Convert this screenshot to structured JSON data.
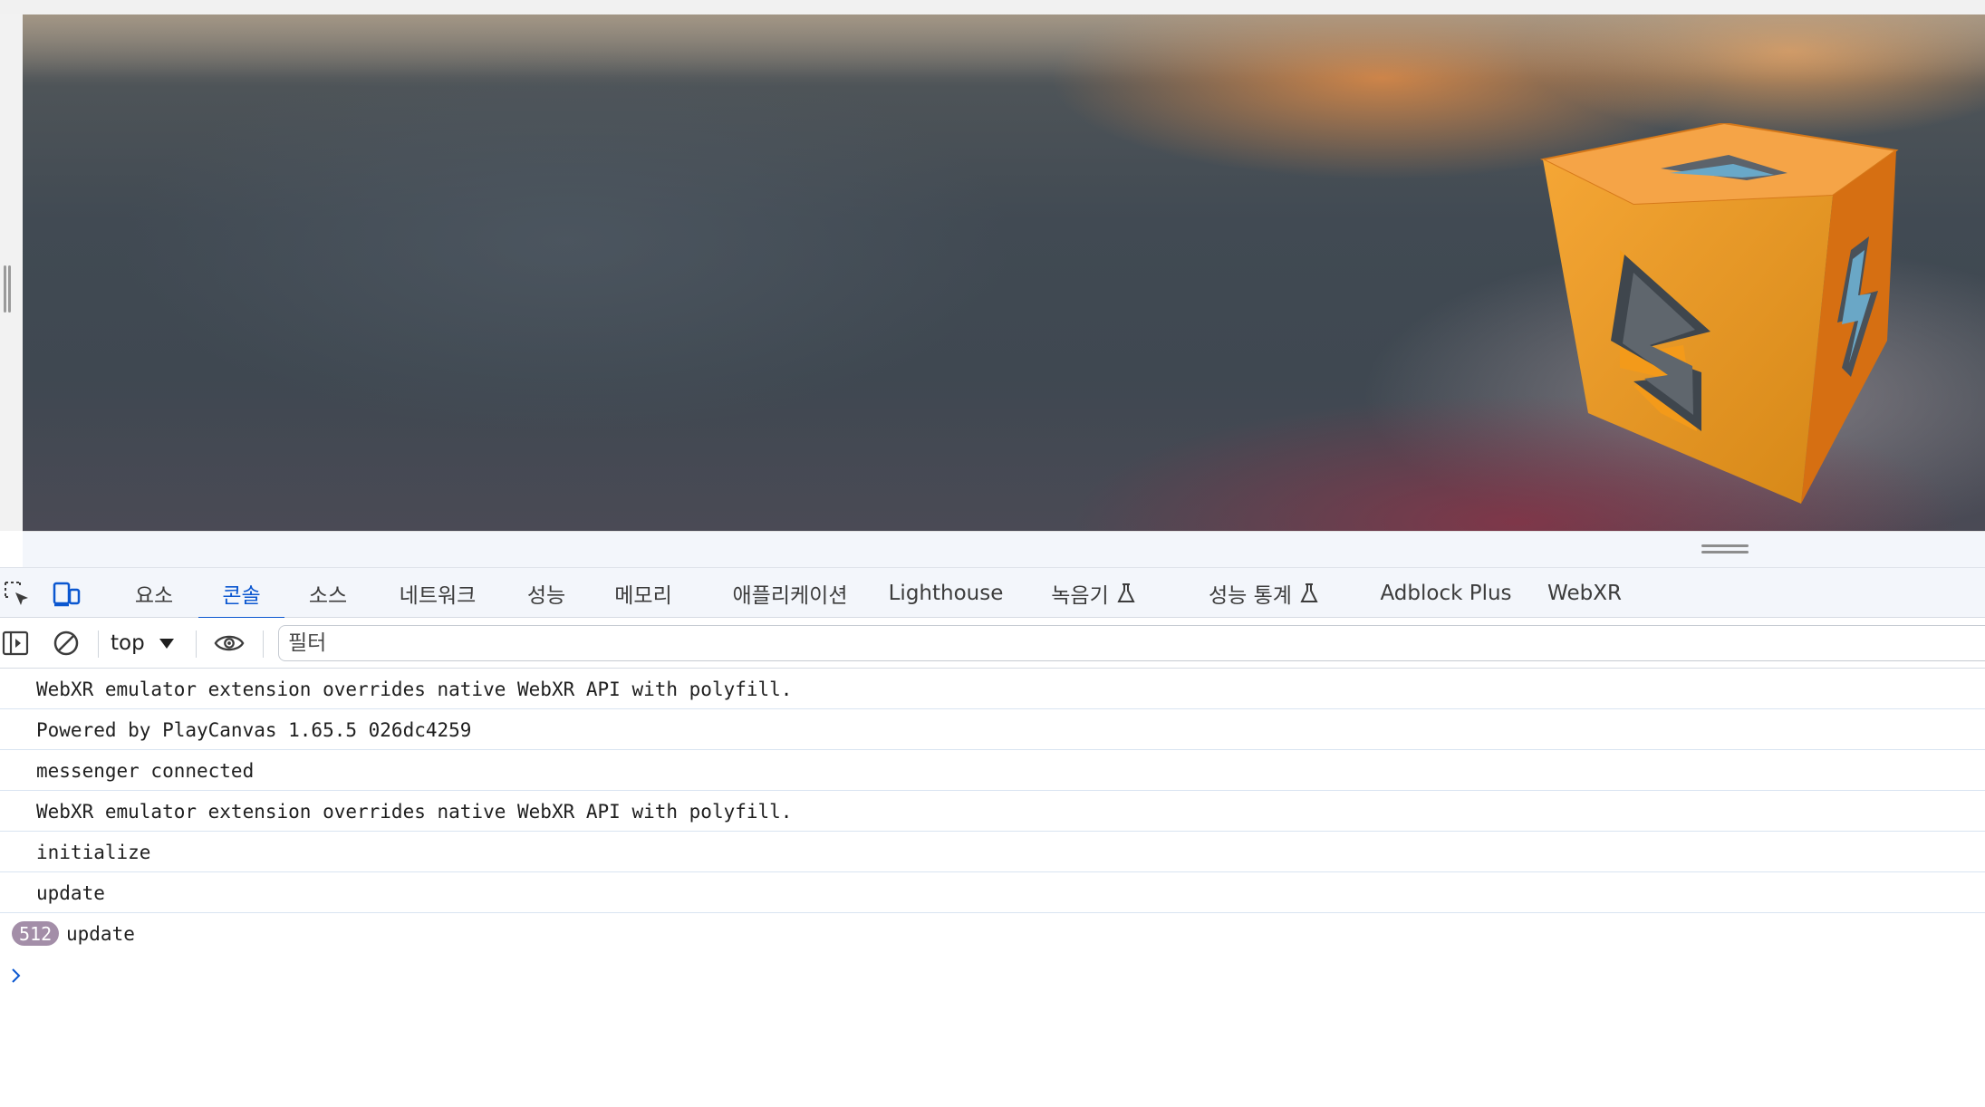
{
  "devtools": {
    "tabs": [
      {
        "label": "요소",
        "active": false
      },
      {
        "label": "콘솔",
        "active": true
      },
      {
        "label": "소스",
        "active": false
      },
      {
        "label": "네트워크",
        "active": false
      },
      {
        "label": "성능",
        "active": false
      },
      {
        "label": "메모리",
        "active": false
      },
      {
        "label": "애플리케이션",
        "active": false
      },
      {
        "label": "Lighthouse",
        "active": false
      },
      {
        "label": "녹음기",
        "active": false,
        "icon": "flask-icon"
      },
      {
        "label": "성능 통계",
        "active": false,
        "icon": "flask-icon"
      },
      {
        "label": "Adblock Plus",
        "active": false
      },
      {
        "label": "WebXR",
        "active": false
      }
    ],
    "toolbar": {
      "context": "top",
      "filter_placeholder": "필터"
    },
    "console": {
      "messages": [
        {
          "text": "WebXR emulator extension overrides native WebXR API with polyfill."
        },
        {
          "text": "Powered by PlayCanvas 1.65.5 026dc4259"
        },
        {
          "text": "messenger connected"
        },
        {
          "text": "WebXR emulator extension overrides native WebXR API with polyfill."
        },
        {
          "text": "initialize"
        },
        {
          "text": "update"
        },
        {
          "text": "update",
          "count": "512"
        }
      ]
    }
  },
  "colors": {
    "accent": "#0b57d0",
    "badge": "#a38ea8",
    "cube": "#f39a1a",
    "tabbar_bg": "#f3f6fb"
  }
}
